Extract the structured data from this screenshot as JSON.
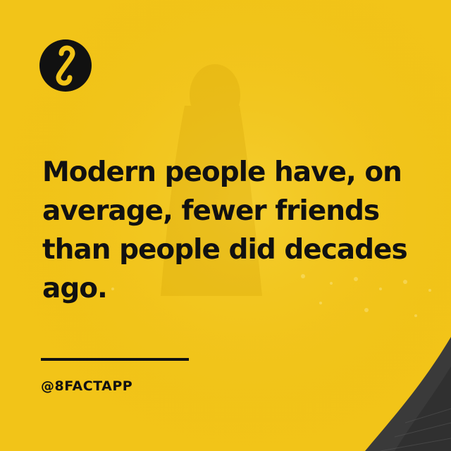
{
  "post": {
    "fact": "Modern people have, on average, fewer friends than people did decades ago.",
    "handle": "@8FACTAPP"
  },
  "logo": {
    "icon": "infinity-eight-icon"
  },
  "colors": {
    "background": "#f2c418",
    "text": "#111111",
    "logo_circle": "#111111",
    "logo_glyph": "#f2c418",
    "corner_photo": "#3a3a3a"
  }
}
